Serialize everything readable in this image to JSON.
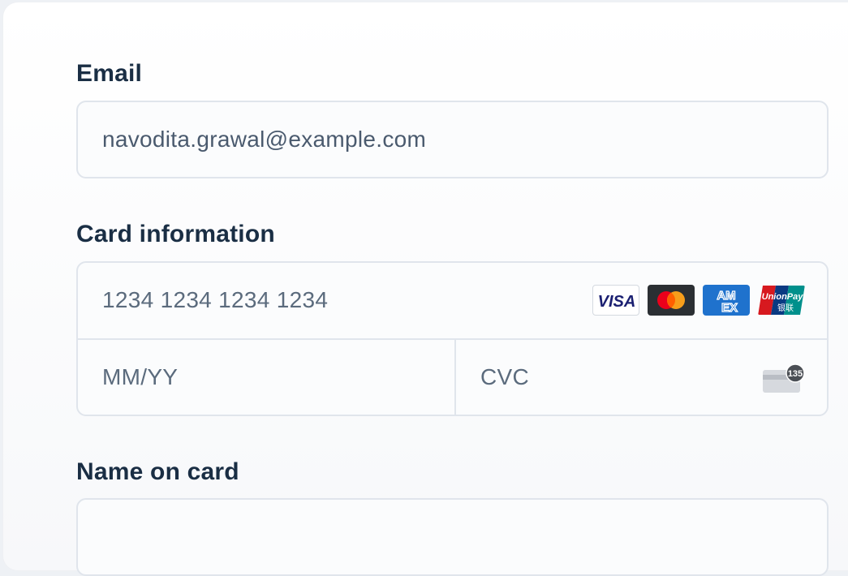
{
  "email": {
    "label": "Email",
    "value": "navodita.grawal@example.com"
  },
  "card_info": {
    "label": "Card information",
    "number_placeholder": "1234 1234 1234 1234",
    "expiry_placeholder": "MM/YY",
    "cvc_placeholder": "CVC",
    "cvc_hint_digits": "135",
    "brands": [
      "visa-icon",
      "mastercard-icon",
      "amex-icon",
      "unionpay-icon"
    ],
    "brand_texts": {
      "visa": "VISA",
      "amex_top": "AM",
      "amex_bottom": "EX",
      "unionpay_top": "UnionPay",
      "unionpay_bottom": "银联"
    }
  },
  "name_on_card": {
    "label": "Name on card",
    "value": ""
  },
  "colors": {
    "label": "#1a2e44",
    "input_text": "#4a5a6e",
    "border": "#e0e5ec",
    "visa_blue": "#1a1f71",
    "mastercard_red": "#eb001b",
    "mastercard_orange": "#f79e1b",
    "amex_blue": "#1f72cd",
    "unionpay_red": "#d7191f",
    "unionpay_blue": "#0a3a82",
    "unionpay_teal": "#00908c"
  }
}
